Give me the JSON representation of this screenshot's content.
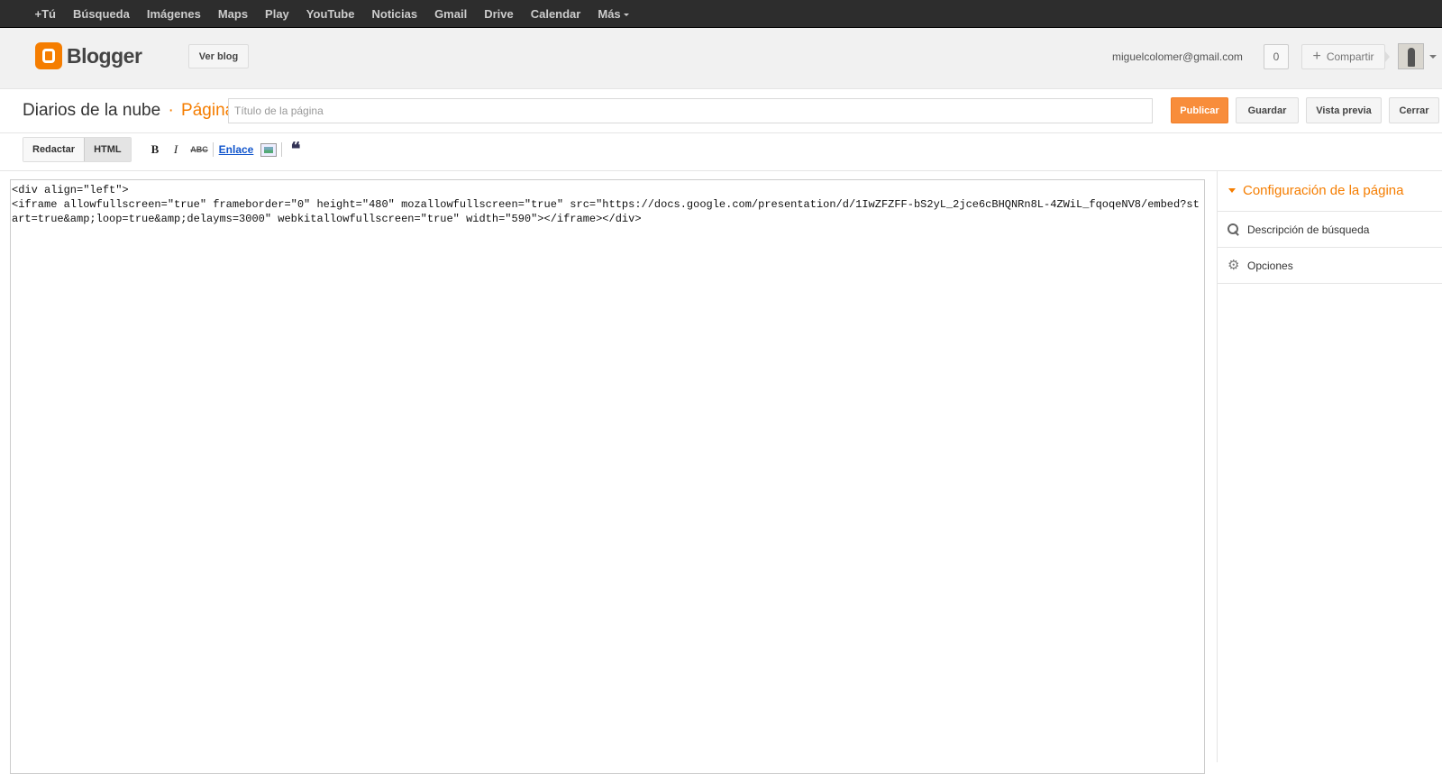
{
  "gbar": {
    "items": [
      "+Tú",
      "Búsqueda",
      "Imágenes",
      "Maps",
      "Play",
      "YouTube",
      "Noticias",
      "Gmail",
      "Drive",
      "Calendar",
      "Más"
    ]
  },
  "header": {
    "brand": "Blogger",
    "view_blog": "Ver blog",
    "email": "miguelcolomer@gmail.com",
    "notification_count": "0",
    "share": "Compartir"
  },
  "titlerow": {
    "blog_name": "Diarios de la nube",
    "separator": "·",
    "item_type": "Página",
    "title_placeholder": "Título de la página",
    "publish": "Publicar",
    "save": "Guardar",
    "preview": "Vista previa",
    "close": "Cerrar"
  },
  "toolbar": {
    "compose": "Redactar",
    "html": "HTML",
    "bold": "B",
    "italic": "I",
    "strike": "ABC",
    "link": "Enlace",
    "quote": "❝"
  },
  "editor": {
    "content": "<div align=\"left\">\n<iframe allowfullscreen=\"true\" frameborder=\"0\" height=\"480\" mozallowfullscreen=\"true\" src=\"https://docs.google.com/presentation/d/1IwZFZFF-bS2yL_2jce6cBHQNRn8L-4ZWiL_fqoqeNV8/embed?start=true&amp;loop=true&amp;delayms=3000\" webkitallowfullscreen=\"true\" width=\"590\"></iframe></div>"
  },
  "sidebar": {
    "heading": "Configuración de la página",
    "items": [
      "Descripción de búsqueda",
      "Opciones"
    ]
  }
}
